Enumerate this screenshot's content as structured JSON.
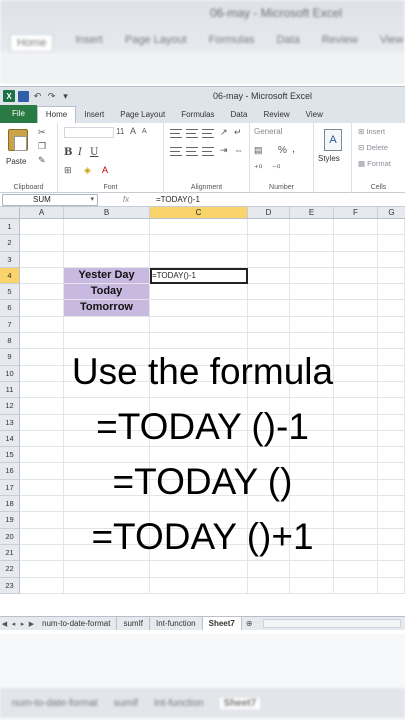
{
  "window": {
    "title": "06-may - Microsoft Excel",
    "blurred_title": "06-may - Microsoft Excel"
  },
  "blurred_tabs": [
    "Home",
    "Insert",
    "Page Layout",
    "Formulas",
    "Data",
    "Review",
    "View"
  ],
  "ribbon": {
    "tabs": [
      "File",
      "Home",
      "Insert",
      "Page Layout",
      "Formulas",
      "Data",
      "Review",
      "View"
    ],
    "active_tab": "Home",
    "groups": {
      "clipboard": "Clipboard",
      "font": "Font",
      "alignment": "Alignment",
      "number": "Number",
      "styles": "",
      "cells": "Cells"
    },
    "paste_label": "Paste",
    "font_size": "11",
    "number_format": "General",
    "styles_label": "Styles",
    "cells_buttons": [
      "Insert",
      "Delete",
      "Format"
    ],
    "percent_symbol": "%",
    "comma_symbol": ","
  },
  "formula_bar": {
    "name_box": "SUM",
    "fx_label": "fx",
    "content": "=TODAY()-1"
  },
  "grid": {
    "columns": [
      "A",
      "B",
      "C",
      "D",
      "E",
      "F",
      "G"
    ],
    "selected_column": "C",
    "rows": [
      "1",
      "2",
      "3",
      "4",
      "5",
      "6",
      "7",
      "8",
      "9",
      "10",
      "11",
      "12",
      "13",
      "14",
      "15",
      "16",
      "17",
      "18",
      "19",
      "20",
      "21",
      "22",
      "23"
    ],
    "selected_row": "4",
    "cells": {
      "B4": "Yester Day",
      "B5": "Today",
      "B6": "Tomorrow",
      "C4": "=TODAY()-1"
    }
  },
  "overlay_text": [
    "Use the formula",
    "=TODAY ()-1",
    "=TODAY ()",
    "=TODAY ()+1"
  ],
  "sheet_tabs": [
    "num-to-date-format",
    "sumIf",
    "Int-function",
    "Sheet7"
  ],
  "active_sheet": "Sheet7",
  "blurred_sheet_tabs": [
    "num-to-date-format",
    "sumIf",
    "Int-function",
    "Sheet7"
  ],
  "colors": {
    "file_tab": "#2a7a44",
    "lavender_cells": "#c9b8df",
    "selected_header": "#f8d46a"
  }
}
